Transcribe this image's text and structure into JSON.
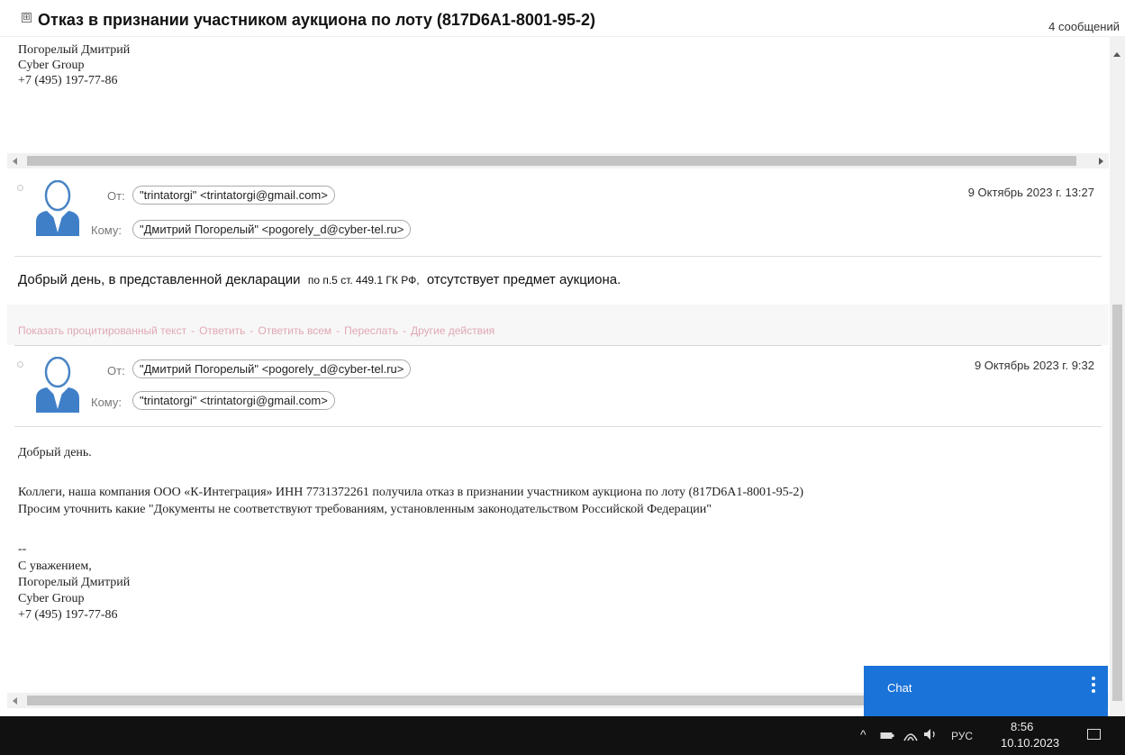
{
  "thread": {
    "title": "Отказ в признании участником аукциона по лоту (817D6A1-8001-95-2)",
    "count": "4 сообщений",
    "toggle": "⊞"
  },
  "top_fragment": {
    "lines": [
      "Погорелый Дмитрий",
      "Cyber Group",
      "+7 (495) 197-77-86"
    ]
  },
  "labels": {
    "from": "От:",
    "to": "Кому:"
  },
  "message1": {
    "from": "\"trintatorgi\" <trintatorgi@gmail.com>",
    "to": "\"Дмитрий Погорелый\" <pogorely_d@cyber-tel.ru>",
    "date": "9 Октябрь 2023 г. 13:27",
    "body_a": "Добрый день, в представленной декларации",
    "body_b": "по п.5 ст. 449.1 ГК РФ,",
    "body_c": "отсутствует предмет аукциона.",
    "actions": [
      "Показать процитированный текст",
      "Ответить",
      "Ответить всем",
      "Переслать",
      "Другие действия"
    ]
  },
  "message2": {
    "from": "\"Дмитрий Погорелый\" <pogorely_d@cyber-tel.ru>",
    "to": "\"trintatorgi\" <trintatorgi@gmail.com>",
    "date": "9 Октябрь 2023 г. 9:32",
    "greeting": "Добрый день.",
    "para1": "Коллеги, наша компания ООО «К-Интеграция» ИНН 7731372261 получила отказ в признании участником аукциона по лоту (817D6A1-8001-95-2)",
    "para2": "Просим уточнить какие \"Документы не соответствуют требованиям, установленным законодательством Российской Федерации\"",
    "sig_sep": "--",
    "sig": [
      "С уважением,",
      "Погорелый Дмитрий",
      "Cyber Group",
      "+7 (495) 197-77-86"
    ]
  },
  "chat": {
    "label": "Chat"
  },
  "taskbar": {
    "lang": "РУС",
    "time": "8:56",
    "date": "10.10.2023"
  }
}
